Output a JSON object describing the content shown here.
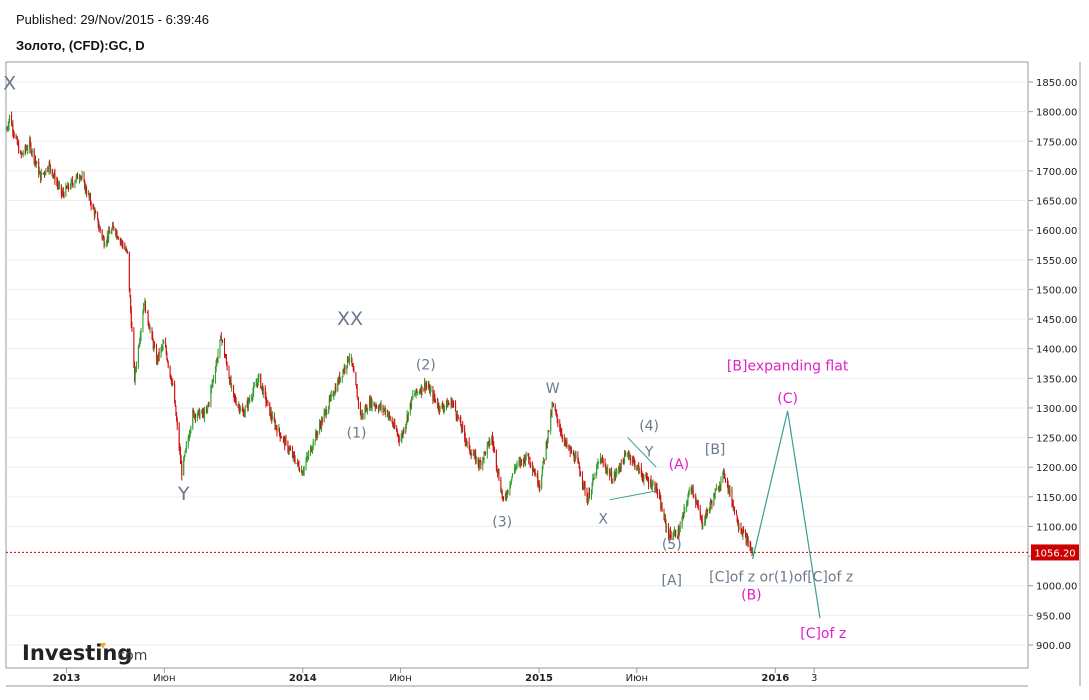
{
  "header": {
    "published": "Published: 29/Nov/2015 - 6:39:46",
    "symbol": "Золото, (CFD):GC, D"
  },
  "logo": {
    "brand": "Investing",
    "suffix": ".com"
  },
  "chart_data": {
    "type": "candlestick",
    "y_range": [
      870,
      1875
    ],
    "y_ticks": [
      900,
      950,
      1000,
      1050,
      1100,
      1150,
      1200,
      1250,
      1300,
      1350,
      1400,
      1450,
      1500,
      1550,
      1600,
      1650,
      1700,
      1750,
      1800,
      1850
    ],
    "y_tick_labels": [
      "900.00",
      "950.00",
      "1000.00",
      "1050.00",
      "1100.00",
      "1150.00",
      "1200.00",
      "1250.00",
      "1300.00",
      "1350.00",
      "1400.00",
      "1450.00",
      "1500.00",
      "1550.00",
      "1600.00",
      "1650.00",
      "1700.00",
      "1750.00",
      "1800.00",
      "1850.00"
    ],
    "x_labels": [
      {
        "label": "2013",
        "date": "2013-01",
        "bold": true
      },
      {
        "label": "Июн",
        "date": "2013-06",
        "bold": false
      },
      {
        "label": "2014",
        "date": "2014-01",
        "bold": true
      },
      {
        "label": "Июн",
        "date": "2014-06",
        "bold": false
      },
      {
        "label": "2015",
        "date": "2015-01",
        "bold": true
      },
      {
        "label": "Июн",
        "date": "2015-06",
        "bold": false
      },
      {
        "label": "2016",
        "date": "2016-01",
        "bold": true
      },
      {
        "label": "3",
        "date": "2016-03",
        "bold": false
      }
    ],
    "last_price": {
      "value": 1056.2,
      "label": "1056.20",
      "color": "#cc0000"
    },
    "colors": {
      "up": "#2e9e2e",
      "down": "#d01010",
      "wave_grey": "#6a7a8c",
      "wave_magenta": "#e020c8",
      "projection": "#3a9e94"
    },
    "price_path": [
      {
        "date": "2012-10-01",
        "price": 1770
      },
      {
        "date": "2012-10-05",
        "price": 1792
      },
      {
        "date": "2012-10-22",
        "price": 1725
      },
      {
        "date": "2012-11-05",
        "price": 1745
      },
      {
        "date": "2012-11-22",
        "price": 1690
      },
      {
        "date": "2012-12-05",
        "price": 1710
      },
      {
        "date": "2012-12-25",
        "price": 1660
      },
      {
        "date": "2013-01-22",
        "price": 1695
      },
      {
        "date": "2013-02-10",
        "price": 1640
      },
      {
        "date": "2013-02-28",
        "price": 1580
      },
      {
        "date": "2013-03-15",
        "price": 1605
      },
      {
        "date": "2013-04-05",
        "price": 1560
      },
      {
        "date": "2013-04-16",
        "price": 1350
      },
      {
        "date": "2013-05-01",
        "price": 1480
      },
      {
        "date": "2013-05-20",
        "price": 1380
      },
      {
        "date": "2013-06-01",
        "price": 1410
      },
      {
        "date": "2013-06-15",
        "price": 1330
      },
      {
        "date": "2013-06-28",
        "price": 1192
      },
      {
        "date": "2013-07-15",
        "price": 1290
      },
      {
        "date": "2013-08-05",
        "price": 1290
      },
      {
        "date": "2013-08-28",
        "price": 1420
      },
      {
        "date": "2013-09-15",
        "price": 1320
      },
      {
        "date": "2013-10-01",
        "price": 1290
      },
      {
        "date": "2013-10-25",
        "price": 1350
      },
      {
        "date": "2013-11-15",
        "price": 1280
      },
      {
        "date": "2013-12-05",
        "price": 1240
      },
      {
        "date": "2013-12-31",
        "price": 1192
      },
      {
        "date": "2014-01-20",
        "price": 1250
      },
      {
        "date": "2014-02-15",
        "price": 1320
      },
      {
        "date": "2014-03-15",
        "price": 1390
      },
      {
        "date": "2014-04-01",
        "price": 1285
      },
      {
        "date": "2014-04-15",
        "price": 1310
      },
      {
        "date": "2014-05-10",
        "price": 1295
      },
      {
        "date": "2014-06-01",
        "price": 1245
      },
      {
        "date": "2014-06-20",
        "price": 1320
      },
      {
        "date": "2014-07-10",
        "price": 1340
      },
      {
        "date": "2014-08-01",
        "price": 1300
      },
      {
        "date": "2014-08-20",
        "price": 1310
      },
      {
        "date": "2014-09-15",
        "price": 1230
      },
      {
        "date": "2014-10-01",
        "price": 1205
      },
      {
        "date": "2014-10-20",
        "price": 1250
      },
      {
        "date": "2014-11-07",
        "price": 1140
      },
      {
        "date": "2014-11-25",
        "price": 1200
      },
      {
        "date": "2014-12-15",
        "price": 1220
      },
      {
        "date": "2015-01-02",
        "price": 1170
      },
      {
        "date": "2015-01-22",
        "price": 1305
      },
      {
        "date": "2015-02-10",
        "price": 1240
      },
      {
        "date": "2015-03-01",
        "price": 1210
      },
      {
        "date": "2015-03-17",
        "price": 1145
      },
      {
        "date": "2015-04-05",
        "price": 1215
      },
      {
        "date": "2015-04-25",
        "price": 1180
      },
      {
        "date": "2015-05-18",
        "price": 1225
      },
      {
        "date": "2015-06-10",
        "price": 1185
      },
      {
        "date": "2015-07-01",
        "price": 1165
      },
      {
        "date": "2015-07-20",
        "price": 1085
      },
      {
        "date": "2015-08-05",
        "price": 1090
      },
      {
        "date": "2015-08-24",
        "price": 1170
      },
      {
        "date": "2015-09-10",
        "price": 1105
      },
      {
        "date": "2015-10-14",
        "price": 1190
      },
      {
        "date": "2015-11-05",
        "price": 1105
      },
      {
        "date": "2015-11-27",
        "price": 1056
      }
    ],
    "wave_labels": [
      {
        "text": "X",
        "date": "2012-10-05",
        "price": 1837,
        "color": "grey",
        "size": "large"
      },
      {
        "text": "Y",
        "date": "2013-07-01",
        "price": 1145,
        "color": "grey",
        "size": "large"
      },
      {
        "text": "XX",
        "date": "2014-03-15",
        "price": 1440,
        "color": "grey",
        "size": "large"
      },
      {
        "text": "(1)",
        "date": "2014-03-25",
        "price": 1250,
        "color": "grey"
      },
      {
        "text": "(2)",
        "date": "2014-07-10",
        "price": 1365,
        "color": "grey"
      },
      {
        "text": "(3)",
        "date": "2014-11-05",
        "price": 1100,
        "color": "grey"
      },
      {
        "text": "W",
        "date": "2015-01-22",
        "price": 1325,
        "color": "grey"
      },
      {
        "text": "X",
        "date": "2015-04-10",
        "price": 1105,
        "color": "grey"
      },
      {
        "text": "(4)",
        "date": "2015-06-20",
        "price": 1262,
        "color": "grey"
      },
      {
        "text": "Y",
        "date": "2015-06-20",
        "price": 1218,
        "color": "grey"
      },
      {
        "text": "(A)",
        "date": "2015-08-05",
        "price": 1197,
        "color": "magenta"
      },
      {
        "text": "[B]",
        "date": "2015-09-30",
        "price": 1222,
        "color": "grey"
      },
      {
        "text": "(5)",
        "date": "2015-07-25",
        "price": 1062,
        "color": "grey"
      },
      {
        "text": "[A]",
        "date": "2015-07-25",
        "price": 1001,
        "color": "grey"
      },
      {
        "text": "(B)",
        "date": "2015-11-25",
        "price": 977,
        "color": "magenta"
      },
      {
        "text": "[C]of z or(1)of[C]of z",
        "date": "2016-01-10",
        "price": 1007,
        "color": "grey"
      },
      {
        "text": "[B]expanding flat",
        "date": "2016-01-20",
        "price": 1363,
        "color": "magenta"
      },
      {
        "text": "(C)",
        "date": "2016-01-20",
        "price": 1308,
        "color": "magenta"
      },
      {
        "text": "[C]of z",
        "date": "2016-03-15",
        "price": 912,
        "color": "magenta"
      }
    ],
    "projection": [
      {
        "date": "2015-11-27",
        "price": 1045
      },
      {
        "date": "2016-01-20",
        "price": 1295
      },
      {
        "date": "2016-03-10",
        "price": 945
      }
    ],
    "triangle_lines": [
      [
        {
          "date": "2015-05-18",
          "price": 1250
        },
        {
          "date": "2015-07-01",
          "price": 1200
        }
      ],
      [
        {
          "date": "2015-04-20",
          "price": 1145
        },
        {
          "date": "2015-07-01",
          "price": 1160
        }
      ]
    ]
  }
}
